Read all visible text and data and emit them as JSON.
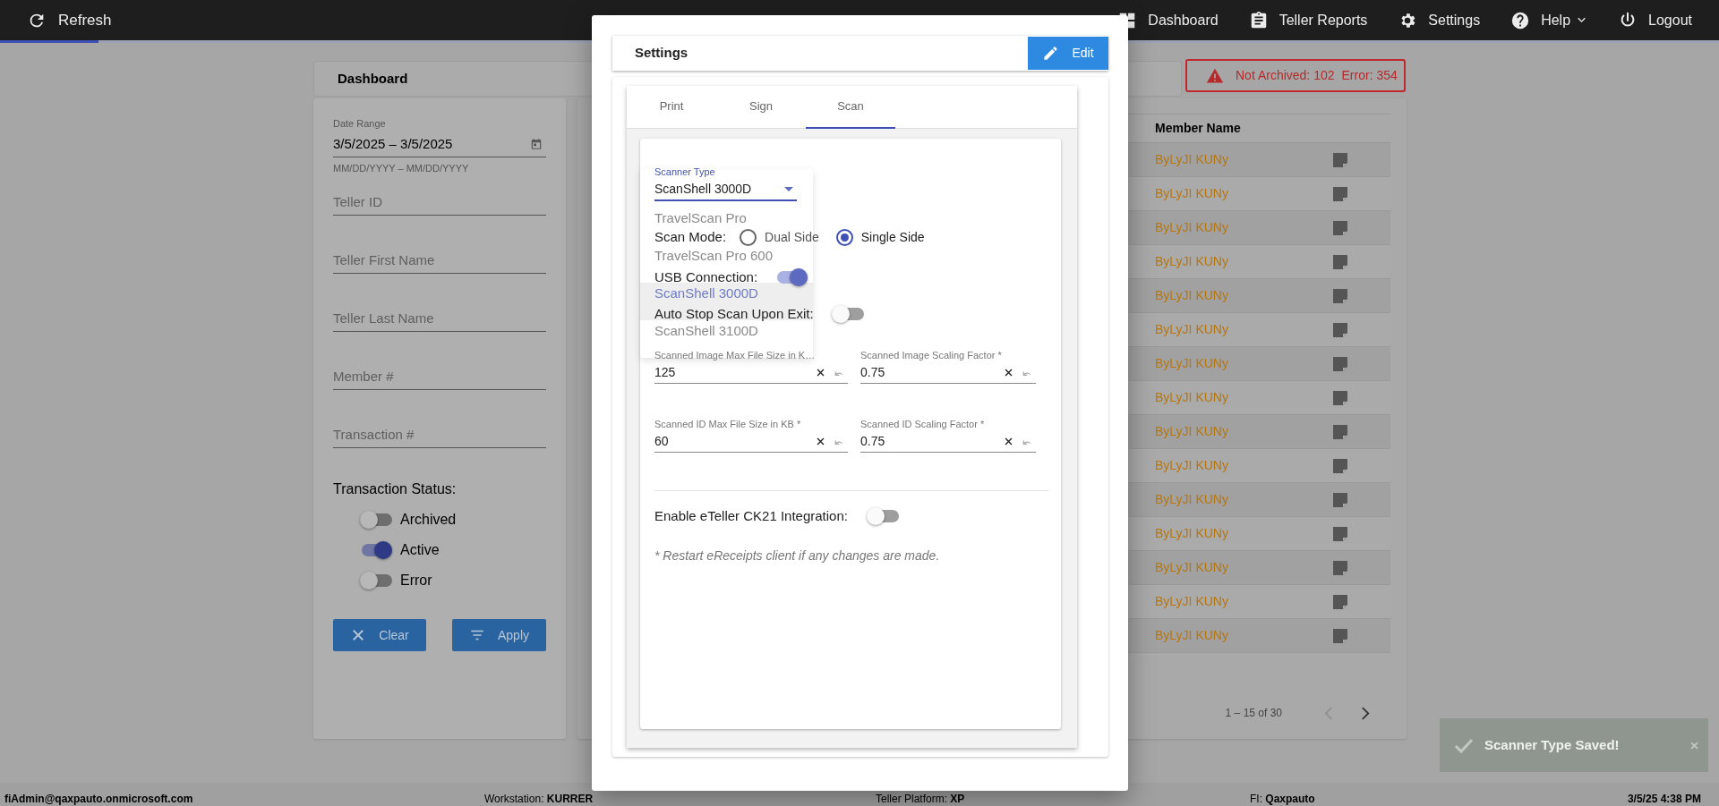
{
  "top_bar": {
    "refresh": "Refresh",
    "nav": [
      {
        "label": "Dashboard",
        "kind": "dashboard",
        "has_menu": false
      },
      {
        "label": "Teller Reports",
        "kind": "reports",
        "has_menu": false
      },
      {
        "label": "Settings",
        "kind": "settings",
        "has_menu": false
      },
      {
        "label": "Help",
        "kind": "help",
        "has_menu": true
      },
      {
        "label": "Logout",
        "kind": "logout",
        "has_menu": false
      }
    ]
  },
  "page_header": {
    "title": "Dashboard"
  },
  "alert": {
    "not_archived": "Not Archived: 102",
    "error": "Error: 354"
  },
  "filters": {
    "date_range": {
      "label": "Date Range",
      "value": "3/5/2025 – 3/5/2025",
      "hint": "MM/DD/YYYY – MM/DD/YYYY"
    },
    "fields": [
      {
        "placeholder": "Teller ID"
      },
      {
        "placeholder": "Teller First Name"
      },
      {
        "placeholder": "Teller Last Name"
      },
      {
        "placeholder": "Member #"
      },
      {
        "placeholder": "Transaction #"
      }
    ],
    "status_label": "Transaction Status:",
    "statuses": [
      {
        "label": "Archived",
        "on": false
      },
      {
        "label": "Active",
        "on": true
      },
      {
        "label": "Error",
        "on": false
      }
    ],
    "buttons": [
      {
        "label": "Clear",
        "kind": "clear"
      },
      {
        "label": "Apply",
        "kind": "apply"
      }
    ]
  },
  "table": {
    "columns": [
      "Member Name"
    ],
    "rows": [
      {
        "member_name": "ByLyJI KUNy"
      },
      {
        "member_name": "ByLyJI KUNy"
      },
      {
        "member_name": "ByLyJI KUNy"
      },
      {
        "member_name": "ByLyJI KUNy"
      },
      {
        "member_name": "ByLyJI KUNy"
      },
      {
        "member_name": "ByLyJI KUNy"
      },
      {
        "member_name": "ByLyJI KUNy"
      },
      {
        "member_name": "ByLyJI KUNy"
      },
      {
        "member_name": "ByLyJI KUNy"
      },
      {
        "member_name": "ByLyJI KUNy"
      },
      {
        "member_name": "ByLyJI KUNy"
      },
      {
        "member_name": "ByLyJI KUNy"
      },
      {
        "member_name": "ByLyJI KUNy"
      },
      {
        "member_name": "ByLyJI KUNy"
      },
      {
        "member_name": "ByLyJI KUNy"
      }
    ]
  },
  "pagination": {
    "range": "1 – 15 of 30",
    "buttons": [
      {
        "kind": "previous",
        "disabled": true
      },
      {
        "kind": "next",
        "disabled": false
      }
    ]
  },
  "settings_dialog": {
    "title": "Settings",
    "edit_button": "Edit",
    "tabs": [
      {
        "label": "Print",
        "selected": false
      },
      {
        "label": "Sign",
        "selected": false
      },
      {
        "label": "Scan",
        "selected": true
      }
    ],
    "scanner_type": {
      "label": "Scanner Type",
      "value": "ScanShell 3000D",
      "options": [
        {
          "label": "TravelScan Pro",
          "selected": false
        },
        {
          "label": "TravelScan Pro 600",
          "selected": false
        },
        {
          "label": "ScanShell 3000D",
          "selected": true
        },
        {
          "label": "ScanShell 3100D",
          "selected": false
        }
      ]
    },
    "scan_mode": {
      "label": "Scan Mode:",
      "options": [
        {
          "label": "Dual Side",
          "selected": false
        },
        {
          "label": "Single Side",
          "selected": true
        }
      ]
    },
    "toggles": [
      {
        "label": "USB Connection:",
        "on": true
      },
      {
        "label": "Auto Stop Scan Upon Exit:",
        "on": false
      }
    ],
    "fields": [
      {
        "label": "Scanned Image Max File Size in K…",
        "value": "125"
      },
      {
        "label": "Scanned Image Scaling Factor *",
        "value": "0.75"
      },
      {
        "label": "Scanned ID Max File Size in KB *",
        "value": "60"
      },
      {
        "label": "Scanned ID Scaling Factor *",
        "value": "0.75"
      }
    ],
    "integration": {
      "label": "Enable eTeller CK21 Integration:",
      "on": false
    },
    "note": "* Restart eReceipts client if any changes are made."
  },
  "toast": {
    "message": "Scanner Type Saved!"
  },
  "status_bar": {
    "user": "fiAdmin@qaxpauto.onmicrosoft.com",
    "workstation": "Workstation: **KURRER**",
    "platform": "Teller Platform: **XP**",
    "fi": "FI: **Qaxpauto**",
    "datetime": "3/5/25 4:38 PM"
  }
}
